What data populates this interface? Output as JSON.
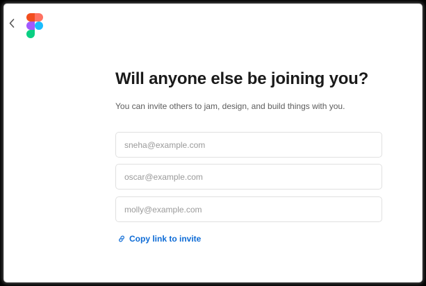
{
  "header": {
    "back_icon": "chevron-left-icon",
    "logo_icon": "figma-logo-icon",
    "logo_colors": [
      "#F24E1E",
      "#FF7262",
      "#A259FF",
      "#1ABCFE",
      "#0ACF83"
    ]
  },
  "main": {
    "title": "Will anyone else be joining you?",
    "subtitle": "You can invite others to jam, design, and build things with you.",
    "invite_fields": [
      {
        "placeholder": "sneha@example.com",
        "value": ""
      },
      {
        "placeholder": "oscar@example.com",
        "value": ""
      },
      {
        "placeholder": "molly@example.com",
        "value": ""
      }
    ],
    "copy_link": {
      "label": "Copy link to invite",
      "icon": "link-icon",
      "color": "#0D6BD6"
    }
  }
}
